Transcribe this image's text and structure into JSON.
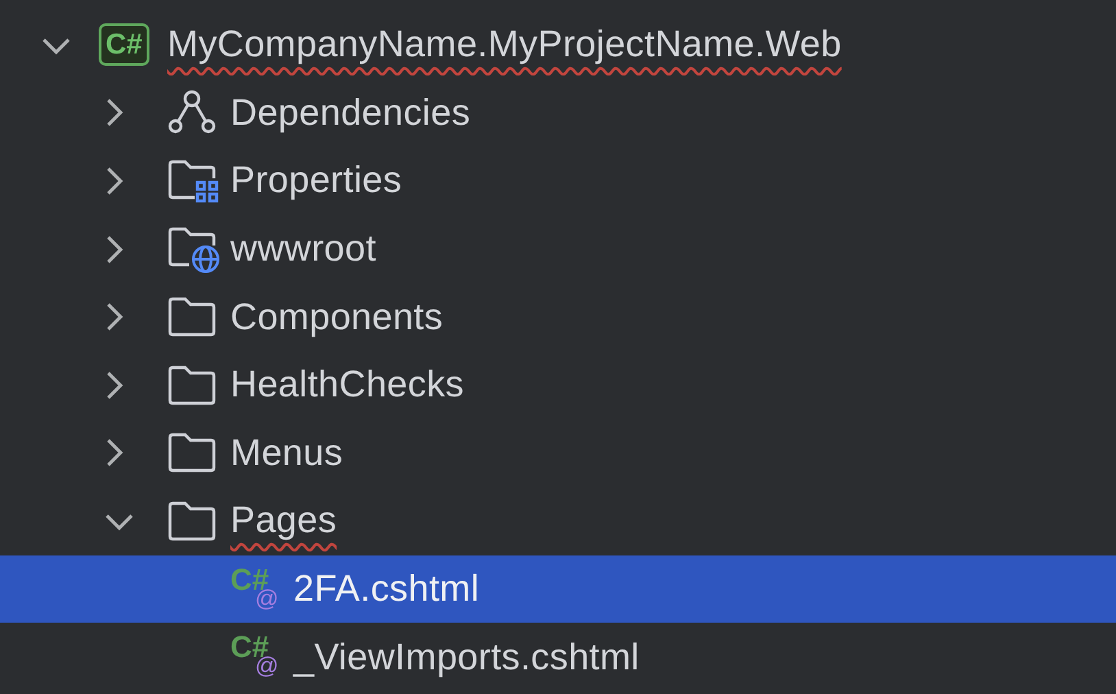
{
  "tree": [
    {
      "label": "MyCompanyName.MyProjectName.Web",
      "kind": "project",
      "icon_text": [
        "C#"
      ],
      "expanded": true,
      "selected": false,
      "misspelled": true,
      "children": [
        {
          "label": "Dependencies",
          "kind": "dependencies",
          "expanded": false,
          "selected": false,
          "misspelled": false
        },
        {
          "label": "Properties",
          "kind": "folder-properties",
          "expanded": false,
          "selected": false,
          "misspelled": false
        },
        {
          "label": "wwwroot",
          "kind": "folder-web",
          "expanded": false,
          "selected": false,
          "misspelled": false
        },
        {
          "label": "Components",
          "kind": "folder",
          "expanded": false,
          "selected": false,
          "misspelled": false
        },
        {
          "label": "HealthChecks",
          "kind": "folder",
          "expanded": false,
          "selected": false,
          "misspelled": false
        },
        {
          "label": "Menus",
          "kind": "folder",
          "expanded": false,
          "selected": false,
          "misspelled": false
        },
        {
          "label": "Pages",
          "kind": "folder",
          "expanded": true,
          "selected": false,
          "misspelled": true,
          "children": [
            {
              "label": "2FA.cshtml",
              "kind": "razor-file",
              "icon_text": [
                "C#",
                "@"
              ],
              "selected": true,
              "misspelled": false
            },
            {
              "label": "_ViewImports.cshtml",
              "kind": "razor-file",
              "icon_text": [
                "C#",
                "@"
              ],
              "selected": false,
              "misspelled": false
            }
          ]
        }
      ]
    }
  ]
}
